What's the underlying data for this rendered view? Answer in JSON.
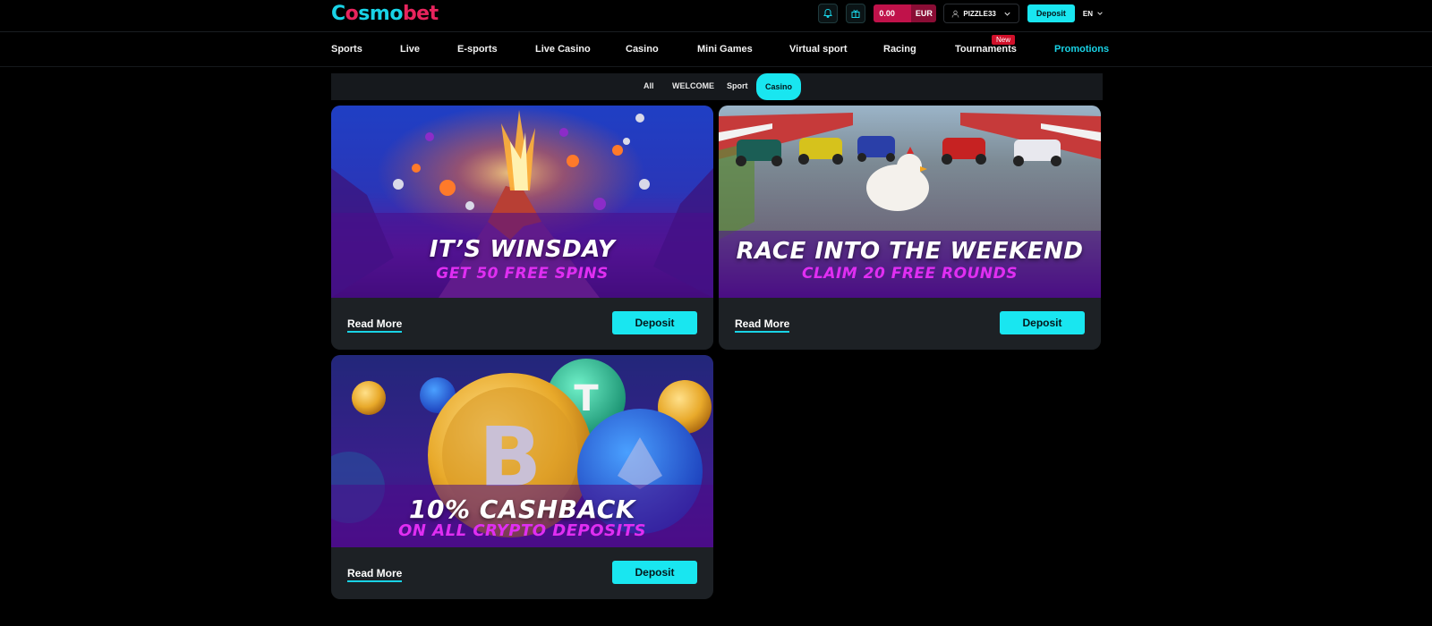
{
  "brand": {
    "logo_part1": "C",
    "logo_part2": "s",
    "logo_part3": "mo",
    "logo_part4": "bet"
  },
  "header": {
    "balance_amount": "0.00",
    "balance_currency": "EUR",
    "username": "PIZZLE33",
    "deposit_label": "Deposit",
    "language": "EN"
  },
  "nav": {
    "items": [
      "Sports",
      "Live",
      "E-sports",
      "Live Casino",
      "Casino",
      "Mini Games",
      "Virtual sport",
      "Racing",
      "Tournaments",
      "Promotions"
    ],
    "new_badge": "New",
    "active": "Promotions"
  },
  "filters": {
    "items": [
      "All",
      "WELCOME",
      "Sport",
      "Casino"
    ],
    "active": "Casino"
  },
  "promotions": [
    {
      "title": "IT’S WINSDAY",
      "subtitle": "GET 50 FREE SPINS",
      "read_more": "Read More",
      "deposit": "Deposit"
    },
    {
      "title": "RACE INTO THE WEEKEND",
      "subtitle": "CLAIM 20 FREE ROUNDS",
      "read_more": "Read More",
      "deposit": "Deposit"
    },
    {
      "title": "10% CASHBACK",
      "subtitle": "ON ALL CRYPTO DEPOSITS",
      "read_more": "Read More",
      "deposit": "Deposit"
    }
  ],
  "colors": {
    "accent": "#19e6f0",
    "brand_pink": "#e8245d",
    "subtitle_magenta": "#e02ef2",
    "card_bg": "#1d2125"
  }
}
